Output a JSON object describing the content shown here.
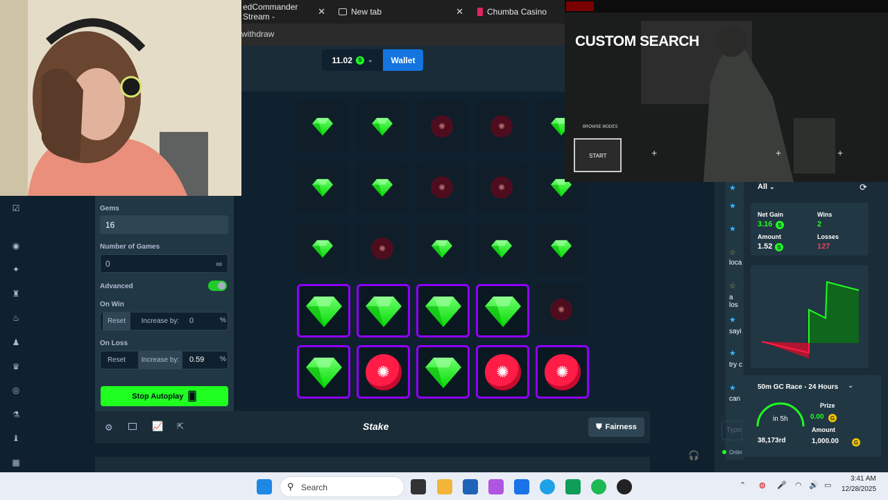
{
  "browser": {
    "tabs": [
      {
        "title": "edCommander Stream -",
        "close": "✕"
      },
      {
        "title": "New tab",
        "close": "✕"
      },
      {
        "title": "Chumba Casino"
      }
    ],
    "url_fragment": "withdraw"
  },
  "header": {
    "balance": "11.02",
    "coin_symbol": "S",
    "wallet_label": "Wallet"
  },
  "controls": {
    "gems_label": "Gems",
    "gems_value": "16",
    "games_label": "Number of Games",
    "games_value": "0",
    "games_infinity": "∞",
    "advanced_label": "Advanced",
    "advanced_on": true,
    "on_win_label": "On Win",
    "on_win_reset": "Reset",
    "on_win_increase": "Increase by:",
    "on_win_value": "0",
    "on_loss_label": "On Loss",
    "on_loss_reset": "Reset",
    "on_loss_increase": "Increase by:",
    "on_loss_value": "0.59",
    "percent": "%",
    "stop_label": "Stop Autoplay"
  },
  "board": {
    "rows": [
      [
        "gem",
        "gem",
        "mine",
        "mine",
        "gem"
      ],
      [
        "gem",
        "gem",
        "mine",
        "mine",
        "gem"
      ],
      [
        "gem",
        "mine",
        "gem",
        "gem",
        "gem"
      ],
      [
        "gem-sel",
        "gem-sel",
        "gem-sel",
        "gem-sel",
        "mine"
      ],
      [
        "gem-sel",
        "mine-sel",
        "gem-sel",
        "mine-sel",
        "mine-sel"
      ]
    ]
  },
  "footer": {
    "logo": "Stake",
    "fairness": "Fairness"
  },
  "stats": {
    "filter": "All",
    "net_gain_label": "Net Gain",
    "net_gain": "3.16",
    "wins_label": "Wins",
    "wins": "2",
    "amount_label": "Amount",
    "amount": "1.52",
    "losses_label": "Losses",
    "losses": "127"
  },
  "chat": {
    "snippets": [
      "loca",
      "a los",
      "sayi",
      "try c",
      "can"
    ],
    "input_placeholder": "Type",
    "online": "Onlin"
  },
  "race": {
    "title": "50m GC Race - 24 Hours",
    "timer": "in 5h",
    "rank": "38,173rd",
    "prize_label": "Prize",
    "prize": "0.00",
    "amount_label": "Amount",
    "amount": "1,000.00",
    "coin_symbol": "G"
  },
  "overlay": {
    "title": "CUSTOM SEARCH",
    "browse": "BROWSE MODES",
    "start": "START",
    "plus": "+"
  },
  "taskbar": {
    "search": "Search",
    "time": "3:41 AM",
    "date": "12/28/2025"
  },
  "colors": {
    "accent_green": "#1fff20",
    "select_purple": "#9000ff",
    "mine_red": "#ff1d47",
    "wallet_blue": "#1475e1"
  }
}
